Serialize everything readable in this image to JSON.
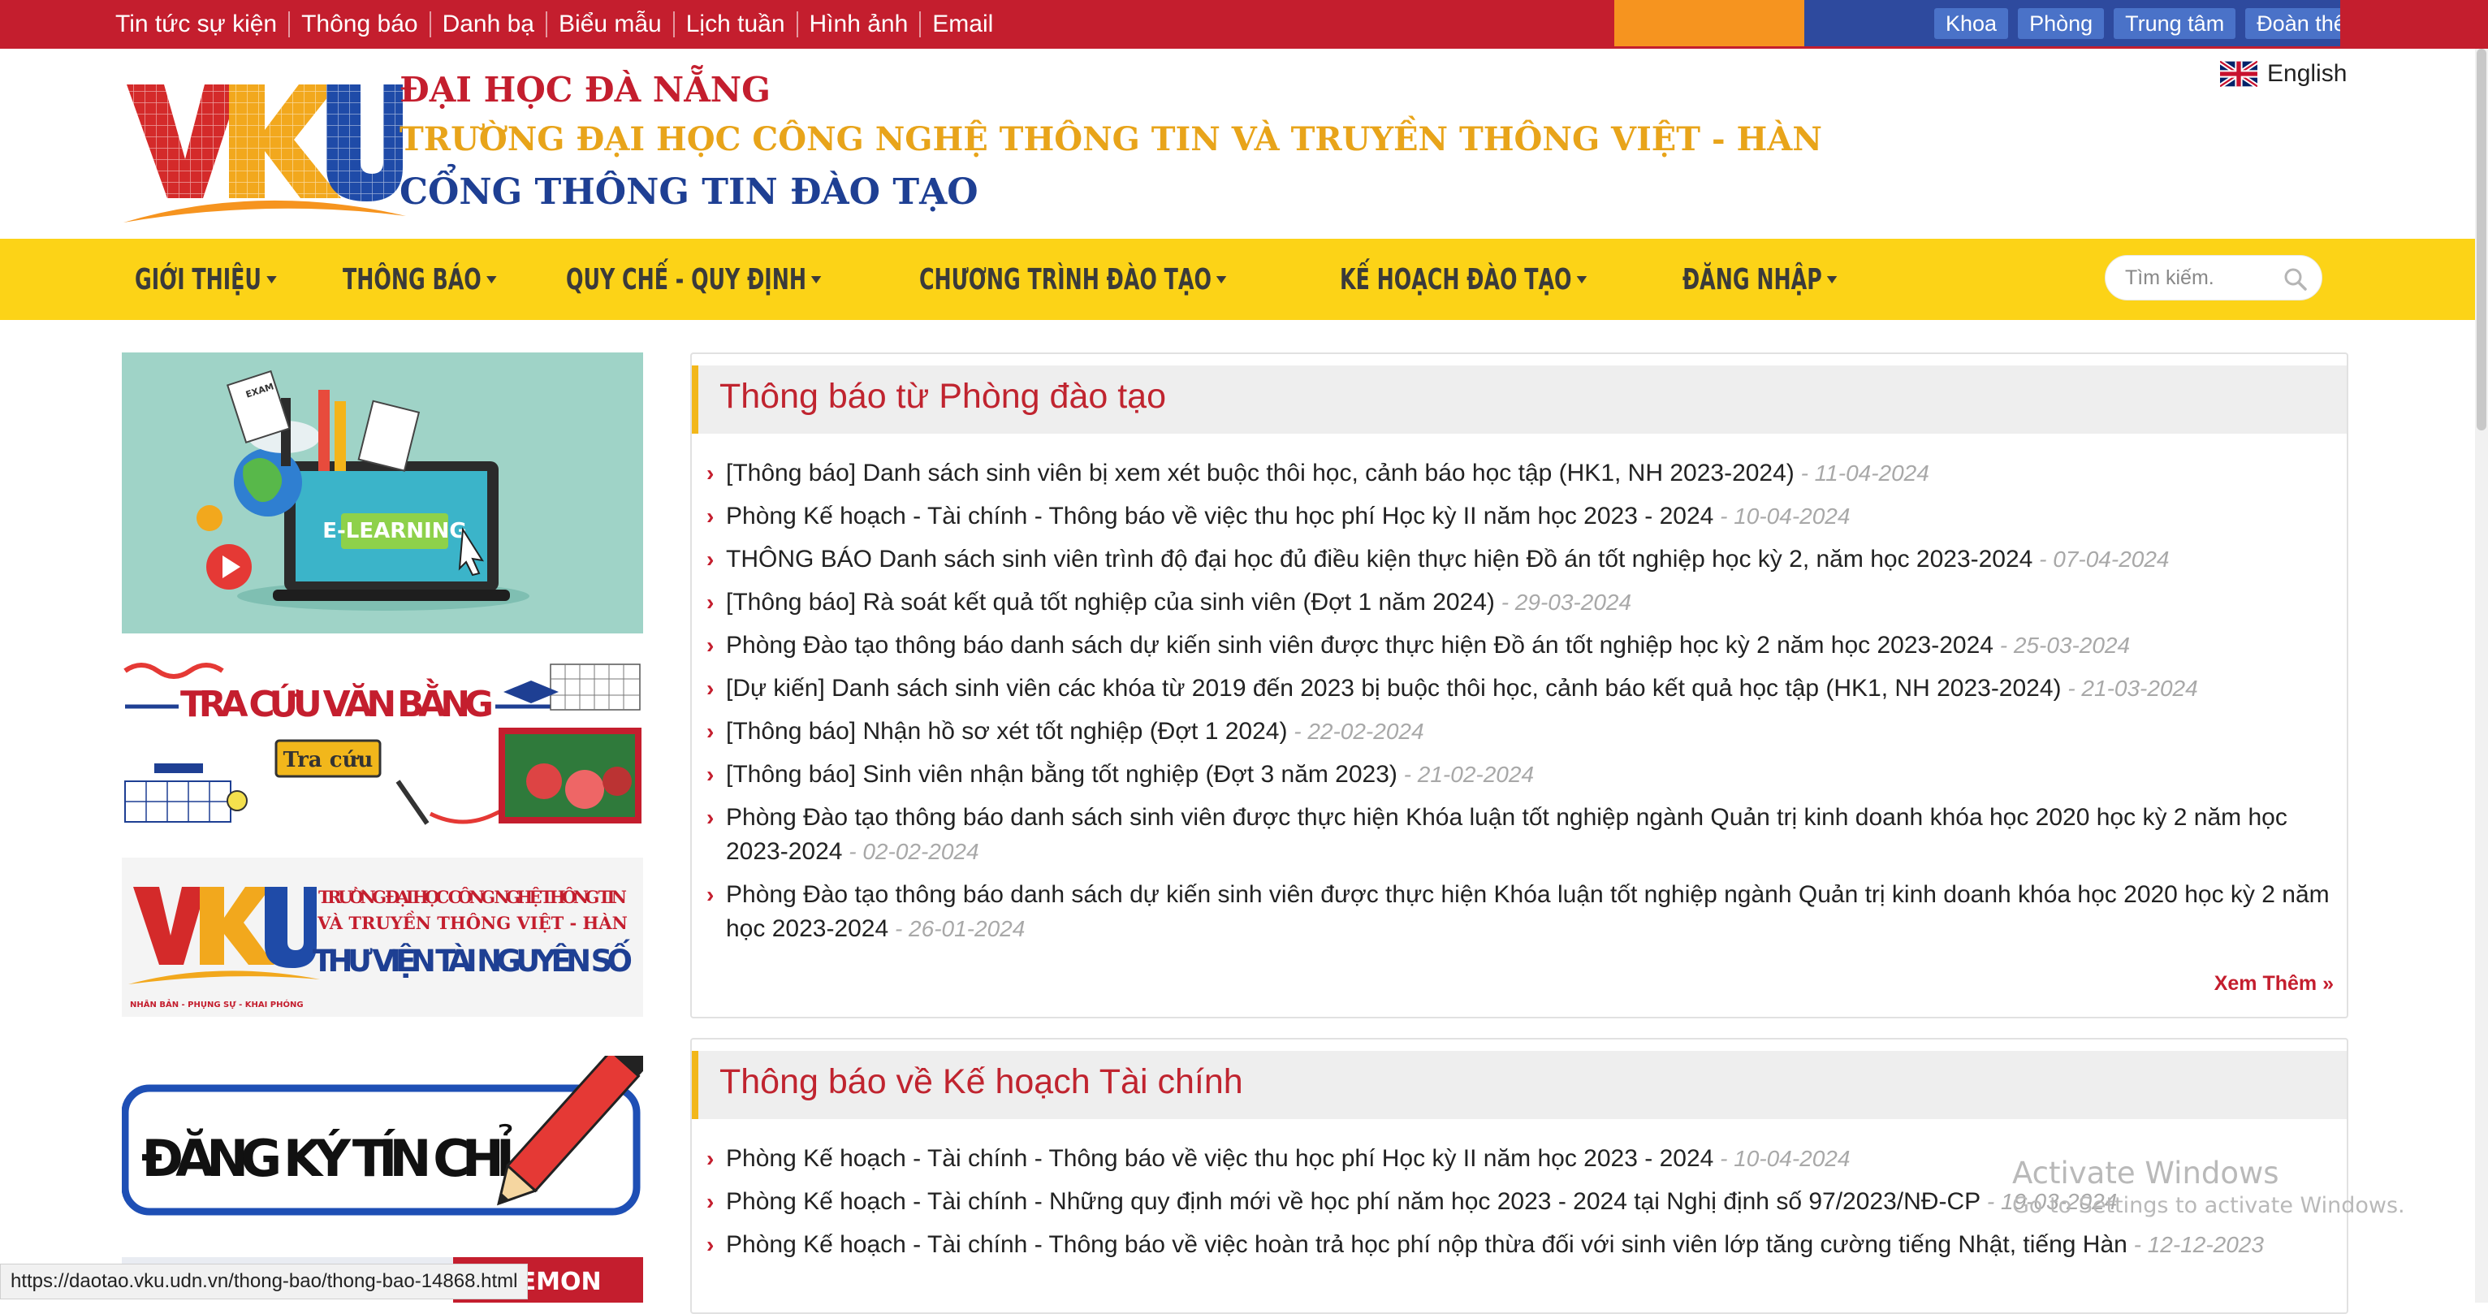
{
  "topbar": {
    "links": [
      "Tin tức sự kiện",
      "Thông báo",
      "Danh bạ",
      "Biểu mẫu",
      "Lịch tuần",
      "Hình ảnh",
      "Email"
    ],
    "quick_links": [
      "Khoa",
      "Phòng",
      "Trung tâm",
      "Đoàn thể"
    ]
  },
  "header": {
    "logo_letters": "VKU",
    "line1": "ĐẠI HỌC ĐÀ NẴNG",
    "line2": "TRƯỜNG ĐẠI HỌC CÔNG NGHỆ THÔNG TIN VÀ TRUYỀN THÔNG VIỆT - HÀN",
    "line3": "CỔNG THÔNG TIN ĐÀO TẠO",
    "language": "English"
  },
  "nav": {
    "items": [
      "GIỚI THIỆU",
      "THÔNG BÁO",
      "QUY CHẾ - QUY ĐỊNH",
      "CHƯƠNG TRÌNH ĐÀO TẠO",
      "KẾ HOẠCH ĐÀO TẠO",
      "ĐĂNG NHẬP"
    ],
    "search_placeholder": "Tìm kiếm."
  },
  "sidebar": {
    "elearning_label": "E-LEARNING",
    "exam_label": "EXAM",
    "tracuu_title": "TRA CỨU VĂN BẰNG",
    "tracuu_button": "Tra cứu",
    "library_school_line1": "TRƯỜNG ĐẠI HỌC CÔNG NGHỆ THÔNG TIN",
    "library_school_line2": "VÀ TRUYỀN THÔNG VIỆT - HÀN",
    "library_title": "THƯ VIỆN TÀI NGUYÊN SỐ",
    "library_motto": "NHÂN BẢN - PHỤNG SỰ - KHAI PHÓNG",
    "dangky_title": "ĐĂNG KÝ TÍN CHỈ",
    "ceremony_label": "CEREMON"
  },
  "panel1": {
    "title": "Thông báo từ Phòng đào tạo",
    "more": "Xem Thêm »",
    "items": [
      {
        "text": "[Thông báo] Danh sách sinh viên bị xem xét buộc thôi học, cảnh báo học tập (HK1, NH 2023-2024)",
        "date": " - 11-04-2024"
      },
      {
        "text": "Phòng Kế hoạch - Tài chính - Thông báo về việc thu học phí Học kỳ II năm học 2023 - 2024",
        "date": " - 10-04-2024"
      },
      {
        "text": "THÔNG BÁO Danh sách sinh viên trình độ đại học đủ điều kiện thực hiện Đồ án tốt nghiệp học kỳ 2, năm học 2023-2024",
        "date": " - 07-04-2024"
      },
      {
        "text": "[Thông báo] Rà soát kết quả tốt nghiệp của sinh viên (Đợt 1 năm 2024)",
        "date": " - 29-03-2024"
      },
      {
        "text": "Phòng Đào tạo thông báo danh sách dự kiến sinh viên được thực hiện Đồ án tốt nghiệp học kỳ 2 năm học 2023-2024",
        "date": " - 25-03-2024"
      },
      {
        "text": "[Dự kiến] Danh sách sinh viên các khóa từ 2019 đến 2023 bị buộc thôi học, cảnh báo kết quả học tập (HK1, NH 2023-2024)",
        "date": " - 21-03-2024"
      },
      {
        "text": "[Thông báo] Nhận hồ sơ xét tốt nghiệp (Đợt 1 2024)",
        "date": " - 22-02-2024"
      },
      {
        "text": "[Thông báo] Sinh viên nhận bằng tốt nghiệp (Đợt 3 năm 2023)",
        "date": " - 21-02-2024"
      },
      {
        "text": "Phòng Đào tạo thông báo danh sách sinh viên được thực hiện Khóa luận tốt nghiệp ngành Quản trị kinh doanh khóa học 2020 học kỳ 2 năm học 2023-2024",
        "date": " - 02-02-2024"
      },
      {
        "text": "Phòng Đào tạo thông báo danh sách dự kiến sinh viên được thực hiện Khóa luận tốt nghiệp ngành Quản trị kinh doanh khóa học 2020 học kỳ 2 năm học 2023-2024",
        "date": " - 26-01-2024"
      }
    ]
  },
  "panel2": {
    "title": "Thông báo về Kế hoạch Tài chính",
    "items": [
      {
        "text": "Phòng Kế hoạch - Tài chính - Thông báo về việc thu học phí Học kỳ II năm học 2023 - 2024",
        "date": " - 10-04-2024"
      },
      {
        "text": "Phòng Kế hoạch - Tài chính - Những quy định mới về học phí năm học 2023 - 2024 tại Nghị định số 97/2023/NĐ-CP",
        "date": " - 19-03-2024"
      },
      {
        "text": "Phòng Kế hoạch - Tài chính - Thông báo về việc hoàn trả học phí nộp thừa đối với sinh viên lớp tăng cường tiếng Nhật, tiếng Hàn",
        "date": " - 12-12-2023"
      }
    ]
  },
  "overlay": {
    "activate_title": "Activate Windows",
    "activate_sub": "Go to Settings to activate Windows.",
    "status_url": "https://daotao.vku.udn.vn/thong-bao/thong-bao-14868.html"
  },
  "colors": {
    "brand_red": "#c41e2e",
    "nav_yellow": "#fcd317",
    "brand_blue": "#1e3f93",
    "brand_orange": "#f6941f"
  }
}
